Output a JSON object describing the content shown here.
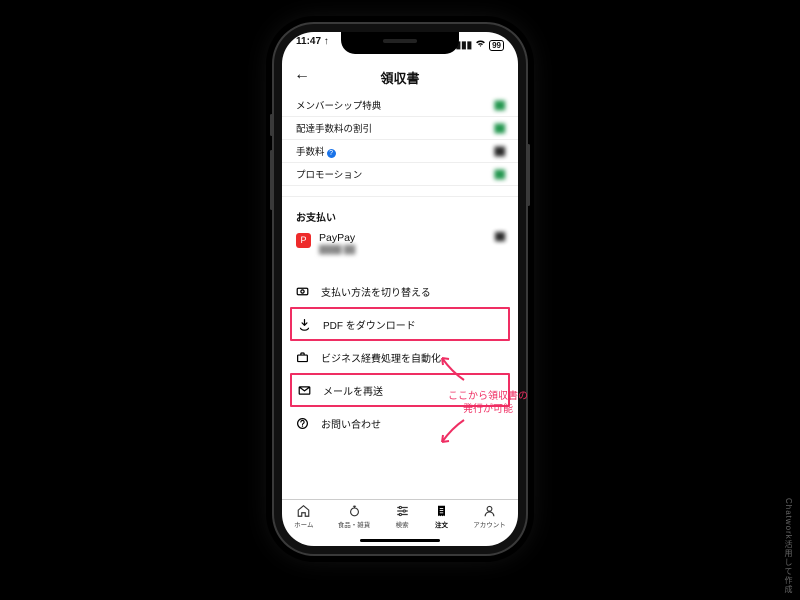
{
  "status": {
    "time": "11:47 ↑",
    "battery": "99"
  },
  "nav": {
    "title": "領収書"
  },
  "summary_rows": [
    {
      "label": "メンバーシップ特典",
      "value": "▇▇",
      "value_class": "mask green",
      "help": false
    },
    {
      "label": "配達手数料の割引",
      "value": "▇▇",
      "value_class": "mask green",
      "help": false
    },
    {
      "label": "手数料",
      "value": "▇▇",
      "value_class": "mask",
      "help": true
    },
    {
      "label": "プロモーション",
      "value": "▇▇",
      "value_class": "mask green",
      "help": false
    }
  ],
  "payment_section": {
    "title": "お支払い"
  },
  "payment": {
    "method_name": "PayPay",
    "method_sub": "████ ██",
    "amount": "▇▇"
  },
  "actions": {
    "switch": "支払い方法を切り替える",
    "pdf": "PDF をダウンロード",
    "expense": "ビジネス経費処理を自動化",
    "resend": "メールを再送",
    "contact": "お問い合わせ"
  },
  "tabs": [
    {
      "label": "ホーム"
    },
    {
      "label": "食品・雑貨"
    },
    {
      "label": "検索"
    },
    {
      "label": "注文"
    },
    {
      "label": "アカウント"
    }
  ],
  "annotation": {
    "line1": "ここから領収書の",
    "line2": "発行が可能"
  },
  "watermark": "Chatwork活用して作成"
}
